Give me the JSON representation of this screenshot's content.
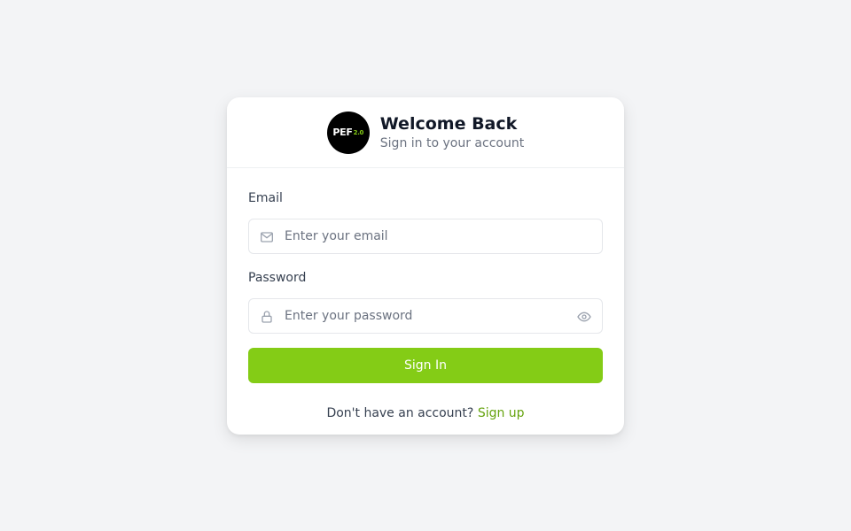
{
  "header": {
    "logo_text": "PEF",
    "logo_version": "2.0",
    "title": "Welcome Back",
    "subtitle": "Sign in to your account"
  },
  "form": {
    "email_label": "Email",
    "email_placeholder": "Enter your email",
    "email_value": "",
    "email_icon": "mail-icon",
    "password_label": "Password",
    "password_placeholder": "Enter your password",
    "password_value": "",
    "password_icon": "lock-icon",
    "password_toggle_icon": "eye-icon",
    "submit_label": "Sign In"
  },
  "footer": {
    "prompt": "Don't have an account?",
    "link_label": "Sign up"
  },
  "colors": {
    "accent": "#84cc16",
    "link": "#65a30d",
    "background": "#f3f4f6"
  }
}
